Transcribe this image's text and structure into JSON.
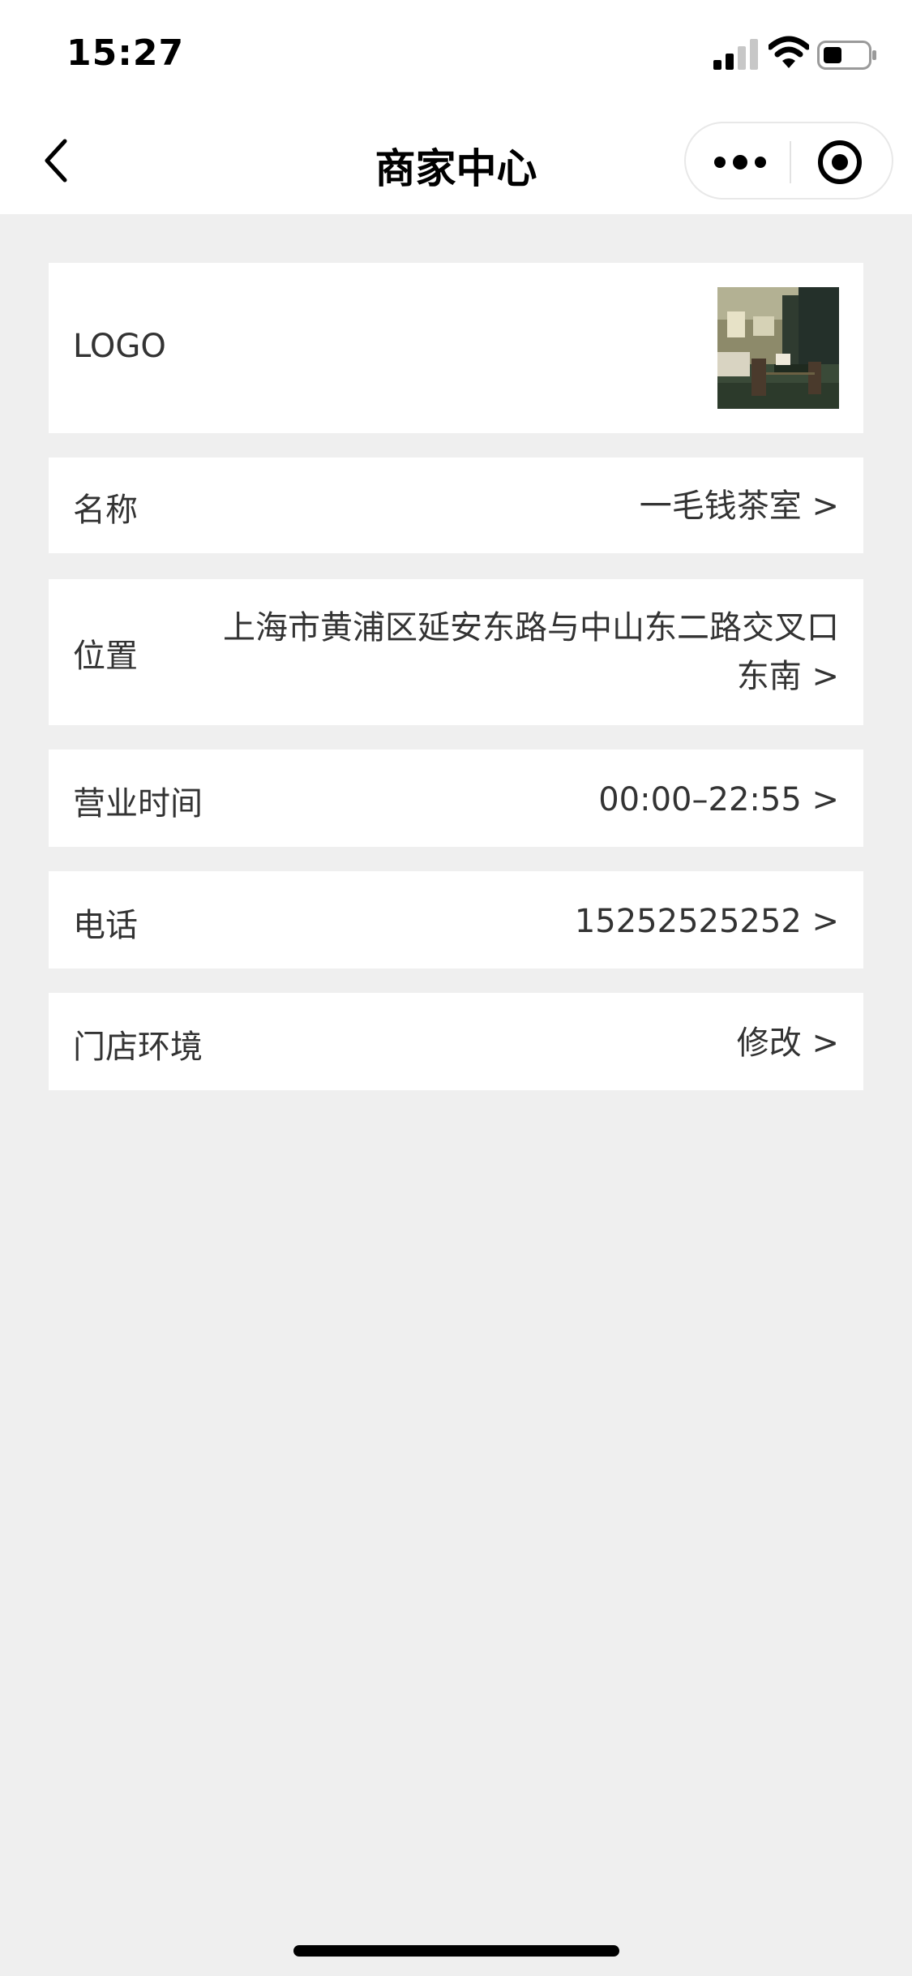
{
  "status_bar": {
    "time": "15:27"
  },
  "nav": {
    "title": "商家中心"
  },
  "profile": {
    "logo_label": "LOGO",
    "name_label": "名称",
    "name_value": "一毛钱茶室 >",
    "location_label": "位置",
    "location_line1": "上海市黄浦区延安东路与中山东二路交叉口",
    "location_line2": "东南 >",
    "hours_label": "营业时间",
    "hours_value": "00:00–22:55 >",
    "phone_label": "电话",
    "phone_value": "15252525252 >",
    "environment_label": "门店环境",
    "environment_value": "修改 >"
  },
  "icons": {
    "back": "chevron-left-icon",
    "more": "more-dots-icon",
    "close": "target-circle-icon",
    "signal": "signal-icon",
    "wifi": "wifi-icon",
    "battery": "battery-icon"
  },
  "colors": {
    "page_background": "#efefef",
    "card_background": "#ffffff",
    "text": "#333333",
    "title": "#000000"
  }
}
